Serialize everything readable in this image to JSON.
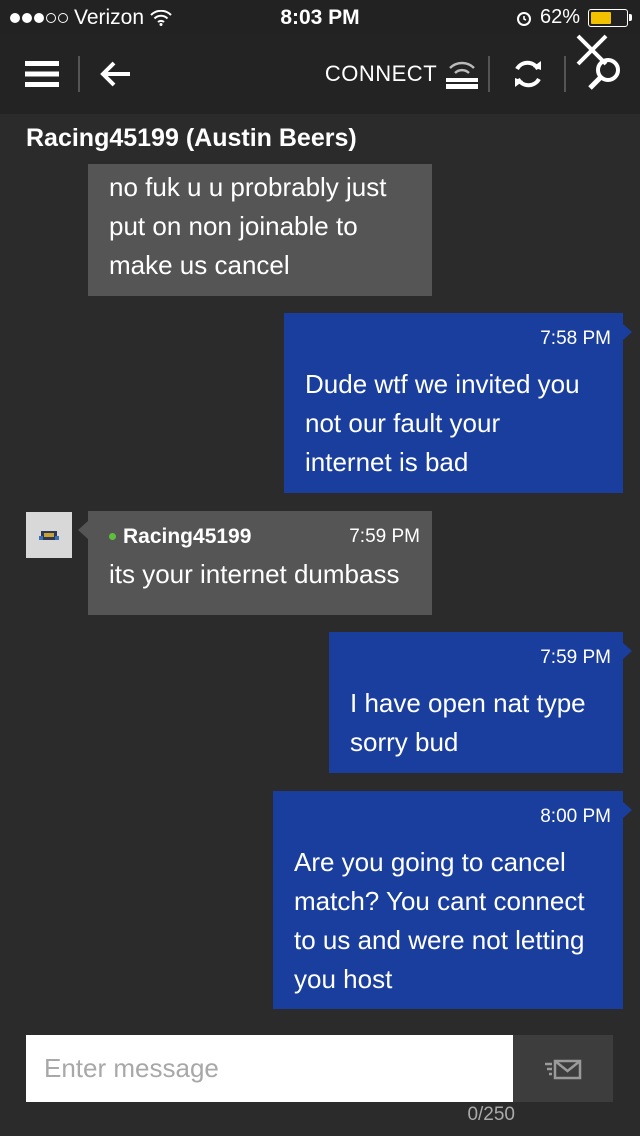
{
  "status_bar": {
    "carrier": "Verizon",
    "time": "8:03 PM",
    "battery": "62%",
    "battery_level": 0.62
  },
  "toolbar": {
    "connect_label": "CONNECT",
    "icons": [
      "menu-icon",
      "back-arrow-icon",
      "wifi-connect-icon",
      "refresh-icon",
      "search-icon",
      "close-icon"
    ]
  },
  "conversation": {
    "contact_title": "Racing45199 (Austin Beers)",
    "messages": [
      {
        "direction": "incoming",
        "text": "no fuk u u probrably just\nput on non joinable to\nmake us cancel"
      },
      {
        "direction": "outgoing",
        "time": "7:58 PM",
        "text": "Dude wtf we invited you\nnot our fault your\ninternet is bad"
      },
      {
        "direction": "incoming",
        "sender": "Racing45199",
        "time": "7:59 PM",
        "text": "its your internet dumbass"
      },
      {
        "direction": "outgoing",
        "time": "7:59 PM",
        "text": "I have open nat type\nsorry bud"
      },
      {
        "direction": "outgoing",
        "time": "8:00 PM",
        "text": "Are you going to cancel\nmatch? You cant connect\nto us and were not letting\nyou host"
      }
    ]
  },
  "composer": {
    "placeholder": "Enter message",
    "value": "",
    "char_count": "0/250"
  },
  "colors": {
    "background": "#2b2b2b",
    "incoming_bubble": "#555555",
    "outgoing_bubble": "#1a3e9d",
    "presence": "#5fbf3a",
    "battery": "#f2c200"
  }
}
